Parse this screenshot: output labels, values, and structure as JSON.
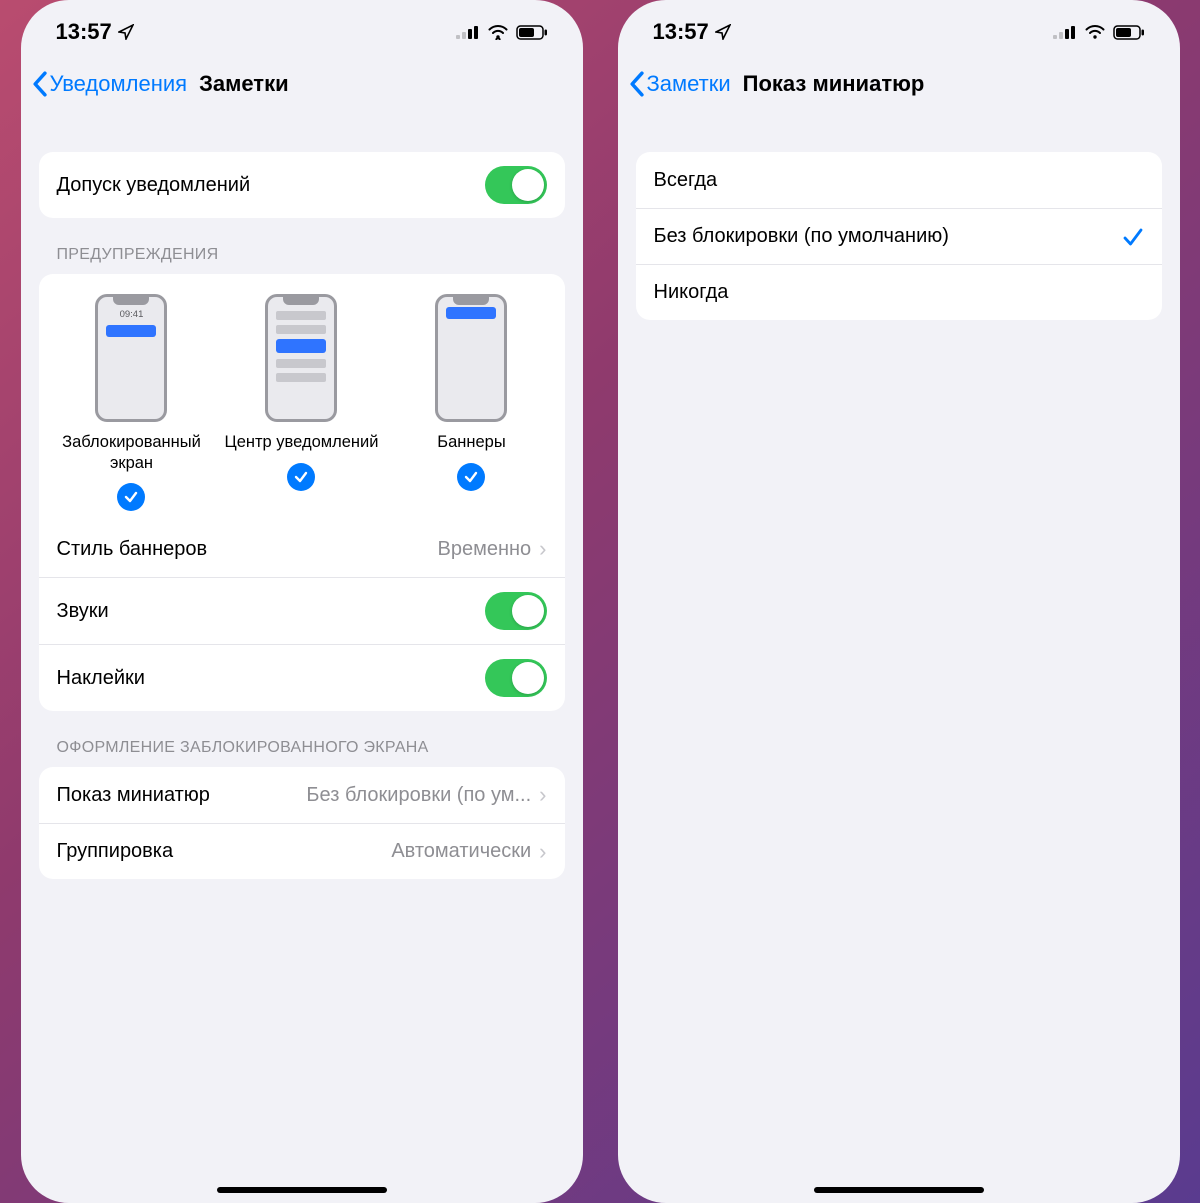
{
  "status": {
    "time": "13:57"
  },
  "left": {
    "back": "Уведомления",
    "title": "Заметки",
    "allow_label": "Допуск уведомлений",
    "section_alerts": "ПРЕДУПРЕЖДЕНИЯ",
    "alerts": {
      "lock": "Заблокированный экран",
      "center": "Центр уведомлений",
      "banners": "Баннеры",
      "lock_time": "09:41"
    },
    "banner_style": {
      "label": "Стиль баннеров",
      "value": "Временно"
    },
    "sounds": "Звуки",
    "badges": "Наклейки",
    "section_lockscreen": "ОФОРМЛЕНИЕ ЗАБЛОКИРОВАННОГО ЭКРАНА",
    "previews": {
      "label": "Показ миниатюр",
      "value": "Без блокировки (по ум..."
    },
    "grouping": {
      "label": "Группировка",
      "value": "Автоматически"
    }
  },
  "right": {
    "back": "Заметки",
    "title": "Показ миниатюр",
    "options": {
      "always": "Всегда",
      "unlocked": "Без блокировки (по умолчанию)",
      "never": "Никогда"
    }
  }
}
